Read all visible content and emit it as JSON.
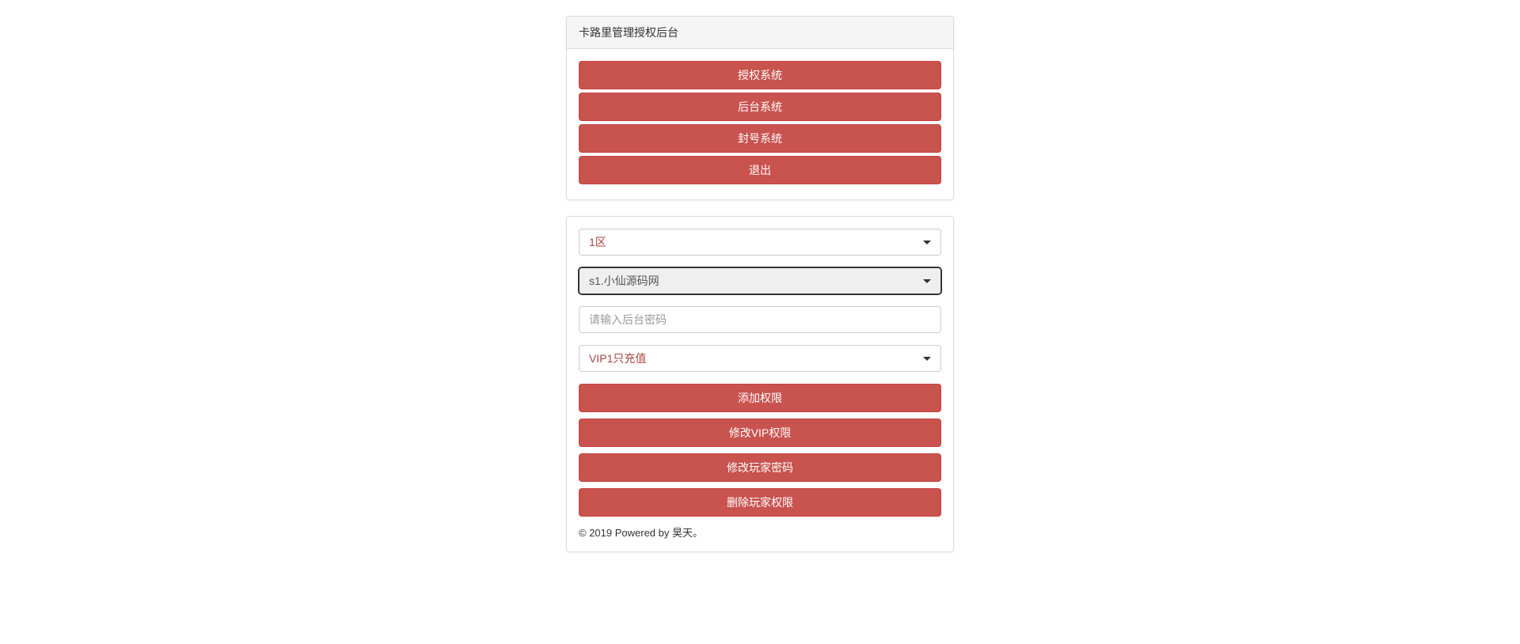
{
  "header": {
    "title": "卡路里管理授权后台"
  },
  "nav": {
    "buttons": [
      {
        "label": "授权系统"
      },
      {
        "label": "后台系统"
      },
      {
        "label": "封号系统"
      },
      {
        "label": "退出"
      }
    ]
  },
  "form": {
    "zoneSelect": {
      "value": "1区"
    },
    "serverSelect": {
      "value": "s1.小仙源码网"
    },
    "passwordInput": {
      "placeholder": "请输入后台密码",
      "value": ""
    },
    "vipSelect": {
      "value": "VIP1只充值"
    },
    "actions": [
      {
        "label": "添加权限"
      },
      {
        "label": "修改VIP权限"
      },
      {
        "label": "修改玩家密码"
      },
      {
        "label": "删除玩家权限"
      }
    ]
  },
  "footer": {
    "text": "© 2019 Powered by 昊天。"
  }
}
